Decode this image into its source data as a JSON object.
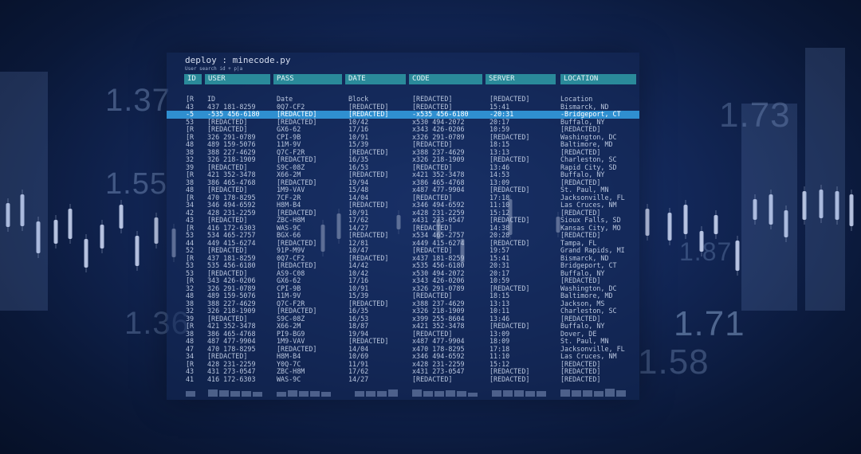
{
  "background_numbers": [
    "1.37",
    "1.55",
    "1.36",
    "1.73",
    "1.87",
    "1.71",
    "1.58"
  ],
  "window": {
    "title": "deploy : minecode.py",
    "subtitle": "User search id + p|a"
  },
  "headers": [
    "ID",
    "USER",
    "PASS",
    "DATE",
    "CODE",
    "SERVER",
    "LOCATION"
  ],
  "column_row": [
    "[R",
    "ID",
    "Date",
    "Block",
    "[REDACTED]",
    "[REDACTED]",
    "Location"
  ],
  "rows": [
    [
      "43",
      "437 181-8259",
      "0Q7-CF2",
      "[REDACTED]",
      "[REDACTED]",
      "15:41",
      "Bismarck, ND"
    ],
    [
      "-5",
      "-535 456-6180",
      "[REDACTED]",
      "[REDACTED]",
      "-x535 456-6180",
      "-20:31",
      "-Bridgeport, CT"
    ],
    [
      "53",
      "[REDACTED]",
      "[REDACTED]",
      "10/42",
      "x530 494-2072",
      "20:17",
      "Buffalo, NY"
    ],
    [
      "[R",
      "[REDACTED]",
      "GX6-62",
      "17/16",
      "x343 426-0206",
      "10:59",
      "[REDACTED]"
    ],
    [
      "[R",
      "326 291-0789",
      "CPI-9B",
      "10/91",
      "x326 291-0789",
      "[REDACTED]",
      "Washington, DC"
    ],
    [
      "48",
      "489 159-5076",
      "11M-9V",
      "15/39",
      "[REDACTED]",
      "18:15",
      "Baltimore, MD"
    ],
    [
      "38",
      "388 227-4629",
      "Q7C-F2R",
      "[REDACTED]",
      "x388 237-4629",
      "13:13",
      "[REDACTED]"
    ],
    [
      "32",
      "326 218-1909",
      "[REDACTED]",
      "16/35",
      "x326 218-1909",
      "[REDACTED]",
      "Charleston, SC"
    ],
    [
      "39",
      "[REDACTED]",
      "S9C-08Z",
      "16/53",
      "[REDACTED]",
      "13:46",
      "Rapid City, SD"
    ],
    [
      "[R",
      "421 352-3478",
      "X66-2M",
      "[REDACTED]",
      "x421 352-3478",
      "14:53",
      "Buffalo, NY"
    ],
    [
      "38",
      "386 465-4768",
      "[REDACTED]",
      "19/94",
      "x386 465-4768",
      "13:09",
      "[REDACTED]"
    ],
    [
      "48",
      "[REDACTED]",
      "1M9-VAV",
      "15/48",
      "x487 477-9904",
      "[REDACTED]",
      "St. Paul, MN"
    ],
    [
      "[R",
      "470 178-8295",
      "7CF-2R",
      "14/04",
      "[REDACTED]",
      "17:18",
      "Jacksonville, FL"
    ],
    [
      "34",
      "346 494-6592",
      "H8M-B4",
      "[REDACTED]",
      "x346 494-6592",
      "11:10",
      "Las Cruces, NM"
    ],
    [
      "42",
      "428 231-2259",
      "[REDACTED]",
      "10/91",
      "x428 231-2259",
      "15:12",
      "[REDACTED]"
    ],
    [
      "43",
      "[REDACTED]",
      "ZBC-H8M",
      "17/62",
      "x431 273-0547",
      "[REDACTED]",
      "Sioux Falls, SD"
    ],
    [
      "[R",
      "416 172-6303",
      "WAS-9C",
      "14/27",
      "[REDACTED]",
      "14:38",
      "Kansas City, MO"
    ],
    [
      "53",
      "534 465-2757",
      "BGX-66",
      "[REDACTED]",
      "x534 465-2757",
      "20:28",
      "[REDACTED]"
    ],
    [
      "44",
      "449 415-6274",
      "[REDACTED]",
      "12/81",
      "x449 415-6274",
      "[REDACTED]",
      "Tampa, FL"
    ],
    [
      "52",
      "[REDACTED]",
      "91P-M9V",
      "10/47",
      "[REDACTED]",
      "19:57",
      "Grand Rapids, MI"
    ],
    [
      "[R",
      "437 181-8259",
      "0Q7-CF2",
      "[REDACTED]",
      "x437 181-8259",
      "15:41",
      "Bismarck, ND"
    ],
    [
      "53",
      "535 456-6180",
      "[REDACTED]",
      "14/42",
      "x535 456-6180",
      "20:31",
      "Bridgeport, CT"
    ],
    [
      "53",
      "[REDACTED]",
      "AS9-C08",
      "10/42",
      "x530 494-2072",
      "20:17",
      "Buffalo, NY"
    ],
    [
      "[R",
      "343 426-0206",
      "GX6-62",
      "17/16",
      "x343 426-0206",
      "10:59",
      "[REDACTED]"
    ],
    [
      "32",
      "326 291-0789",
      "CPI-9B",
      "10/91",
      "x326 291-0789",
      "[REDACTED]",
      "Washington, DC"
    ],
    [
      "48",
      "489 159-5076",
      "11M-9V",
      "15/39",
      "[REDACTED]",
      "18:15",
      "Baltimore, MD"
    ],
    [
      "38",
      "388 227-4629",
      "Q7C-F2R",
      "[REDACTED]",
      "x388 237-4629",
      "13:13",
      "Jackson, MS"
    ],
    [
      "32",
      "326 218-1909",
      "[REDACTED]",
      "16/35",
      "x326 218-1909",
      "10:11",
      "Charleston, SC"
    ],
    [
      "39",
      "[REDACTED]",
      "S9C-08Z",
      "16/53",
      "x399 255-8604",
      "13:46",
      "[REDACTED]"
    ],
    [
      "[R",
      "421 352-3478",
      "X66-2M",
      "18/87",
      "x421 352-3478",
      "[REDACTED]",
      "Buffalo, NY"
    ],
    [
      "38",
      "386 465-4768",
      "PI9-BG9",
      "19/94",
      "[REDACTED]",
      "13:09",
      "Dover, DE"
    ],
    [
      "48",
      "487 477-9904",
      "1M9-VAV",
      "[REDACTED]",
      "x487 477-9904",
      "18:09",
      "St. Paul, MN"
    ],
    [
      "47",
      "470 178-8295",
      "[REDACTED]",
      "14/04",
      "x470 178-8295",
      "17:18",
      "Jacksonville, FL"
    ],
    [
      "34",
      "[REDACTED]",
      "H8M-B4",
      "10/69",
      "x346 494-6592",
      "11:10",
      "Las Cruces, NM"
    ],
    [
      "[R",
      "428 231-2259",
      "Y0Q-7C",
      "11/91",
      "x428 231-2259",
      "15:12",
      "[REDACTED]"
    ],
    [
      "43",
      "431 273-0547",
      "ZBC-H8M",
      "17/62",
      "x431 273-0547",
      "[REDACTED]",
      "[REDACTED]"
    ],
    [
      "41",
      "416 172-6303",
      "WAS-9C",
      "14/27",
      "[REDACTED]",
      "[REDACTED]",
      "[REDACTED]"
    ]
  ],
  "highlight_row": 1,
  "colors": {
    "header": "#2a8a9a",
    "highlight": "#2f8fd0",
    "text": "#b9c6de",
    "candle": "#d8e4ff"
  }
}
